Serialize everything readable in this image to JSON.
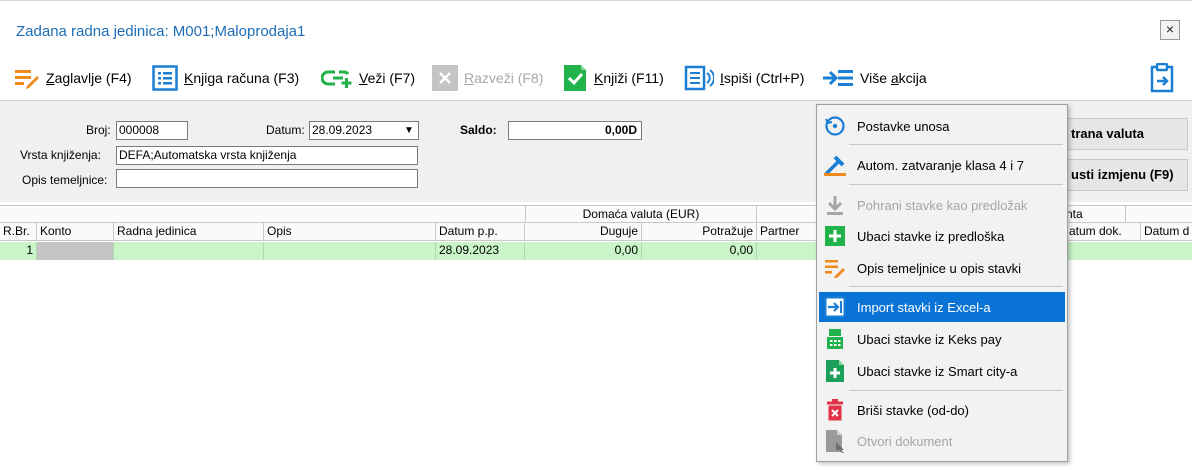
{
  "window": {
    "title": "Zadana radna jedinica: M001;Maloprodaja1",
    "close_glyph": "×"
  },
  "toolbar": {
    "header": {
      "prefix": "",
      "key": "Z",
      "rest": "aglavlje (F4)"
    },
    "ledger": {
      "prefix": "",
      "key": "K",
      "rest": "njiga računa (F3)"
    },
    "link": {
      "prefix": "",
      "key": "V",
      "rest": "eži (F7)"
    },
    "unlink": {
      "prefix": "",
      "key": "R",
      "rest": "azveži (F8)"
    },
    "post": {
      "prefix": "",
      "key": "K",
      "rest": "njiži (F11)"
    },
    "print": {
      "prefix": "",
      "key": "I",
      "rest": "spiši (Ctrl+P)"
    },
    "more": {
      "prefix": "Više ",
      "key": "a",
      "rest": "kcija"
    }
  },
  "form": {
    "broj_label": "Broj:",
    "broj_value": "000008",
    "datum_label": "Datum:",
    "datum_value": "28.09.2023",
    "dropdown_glyph": "▼",
    "saldo_label": "Saldo:",
    "saldo_value": "0,00D",
    "vrsta_label": "Vrsta knjiženja:",
    "vrsta_value": "DEFA;Automatska vrsta knjiženja",
    "opis_label": "Opis temeljnice:",
    "opis_value": "",
    "side_button_1": "trana valuta",
    "side_button_2": "usti izmjenu (F9)"
  },
  "grid": {
    "group_domestic": "Domaća valuta (EUR)",
    "group_partial": "nta",
    "columns": [
      "R.Br.",
      "Konto",
      "Radna jedinica",
      "Opis",
      "Datum p.p.",
      "Duguje",
      "Potražuje",
      "Partner",
      "atum dok.",
      "Datum d"
    ],
    "rows": [
      {
        "rbr": "1",
        "konto": "",
        "radna": "",
        "opis": "",
        "datum_pp": "28.09.2023",
        "duguje": "0,00",
        "potrazuje": "0,00",
        "partner": ""
      }
    ]
  },
  "menu": {
    "items": [
      {
        "label": "Postavke unosa",
        "icon": "refresh-settings-icon",
        "disabled": false,
        "active": false
      },
      {
        "label": "Autom. zatvaranje klasa 4 i 7",
        "icon": "auto-close-icon",
        "disabled": false,
        "active": false
      },
      {
        "label": "Pohrani stavke kao predložak",
        "icon": "download-icon",
        "disabled": true,
        "active": false
      },
      {
        "label": "Ubaci stavke iz predloška",
        "icon": "plus-icon",
        "disabled": false,
        "active": false
      },
      {
        "label": "Opis temeljnice u opis stavki",
        "icon": "edit-lines-icon",
        "disabled": false,
        "active": false
      },
      {
        "label": "Import stavki iz Excel-a",
        "icon": "import-icon",
        "disabled": false,
        "active": true
      },
      {
        "label": "Ubaci stavke iz Keks pay",
        "icon": "pos-terminal-icon",
        "disabled": false,
        "active": false
      },
      {
        "label": "Ubaci stavke iz Smart city-a",
        "icon": "document-plus-icon",
        "disabled": false,
        "active": false
      },
      {
        "label": "Briši stavke (od-do)",
        "icon": "trash-icon",
        "disabled": false,
        "active": false
      },
      {
        "label": "Otvori dokument",
        "icon": "open-document-icon",
        "disabled": true,
        "active": false
      }
    ]
  },
  "colors": {
    "title_blue": "#1e6db6",
    "accent_orange": "#f08a1c",
    "icon_blue": "#1a7fd4",
    "green": "#21b24b",
    "row_green": "#c9f5c9",
    "menu_highlight": "#0a74d6"
  }
}
